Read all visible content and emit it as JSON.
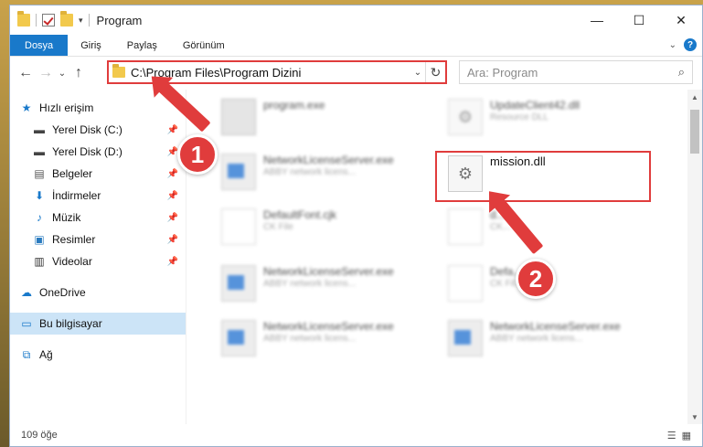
{
  "window": {
    "title": "Program"
  },
  "ribbon": {
    "tabs": [
      "Dosya",
      "Giriş",
      "Paylaş",
      "Görünüm"
    ]
  },
  "address": {
    "path": "C:\\Program Files\\Program Dizini"
  },
  "search": {
    "placeholder": "Ara: Program"
  },
  "sidebar": {
    "quick_access": "Hızlı erişim",
    "items": [
      {
        "label": "Yerel Disk (C:)",
        "icon": "drive-icon"
      },
      {
        "label": "Yerel Disk (D:)",
        "icon": "drive-icon"
      },
      {
        "label": "Belgeler",
        "icon": "documents-icon"
      },
      {
        "label": "İndirmeler",
        "icon": "download-icon"
      },
      {
        "label": "Müzik",
        "icon": "music-icon"
      },
      {
        "label": "Resimler",
        "icon": "pictures-icon"
      },
      {
        "label": "Videolar",
        "icon": "videos-icon"
      }
    ],
    "onedrive": "OneDrive",
    "this_pc": "Bu bilgisayar",
    "network": "Ağ"
  },
  "files": [
    {
      "name": "program.exe",
      "desc": ""
    },
    {
      "name": "UpdateClient42.dll",
      "desc": "Resource DLL"
    },
    {
      "name": "NetworkLicenseServer.exe",
      "desc": "ABBY network licens..."
    },
    {
      "name": "mission.dll",
      "desc": ""
    },
    {
      "name": "DefaultFont.cjk",
      "desc": "CK File"
    },
    {
      "name": "d...",
      "desc": "CK..."
    },
    {
      "name": "NetworkLicenseServer.exe",
      "desc": "ABBY network licens..."
    },
    {
      "name": "Defa...jk",
      "desc": "CK Fil..."
    },
    {
      "name": "NetworkLicenseServer.exe",
      "desc": "ABBY network licens..."
    },
    {
      "name": "NetworkLicenseServer.exe",
      "desc": "ABBY network licens..."
    }
  ],
  "status": {
    "count": "109 öğe"
  },
  "annotations": {
    "badge1": "1",
    "badge2": "2"
  },
  "colors": {
    "accent": "#1979ca",
    "highlight": "#e03c3c",
    "selected": "#cce4f7"
  }
}
